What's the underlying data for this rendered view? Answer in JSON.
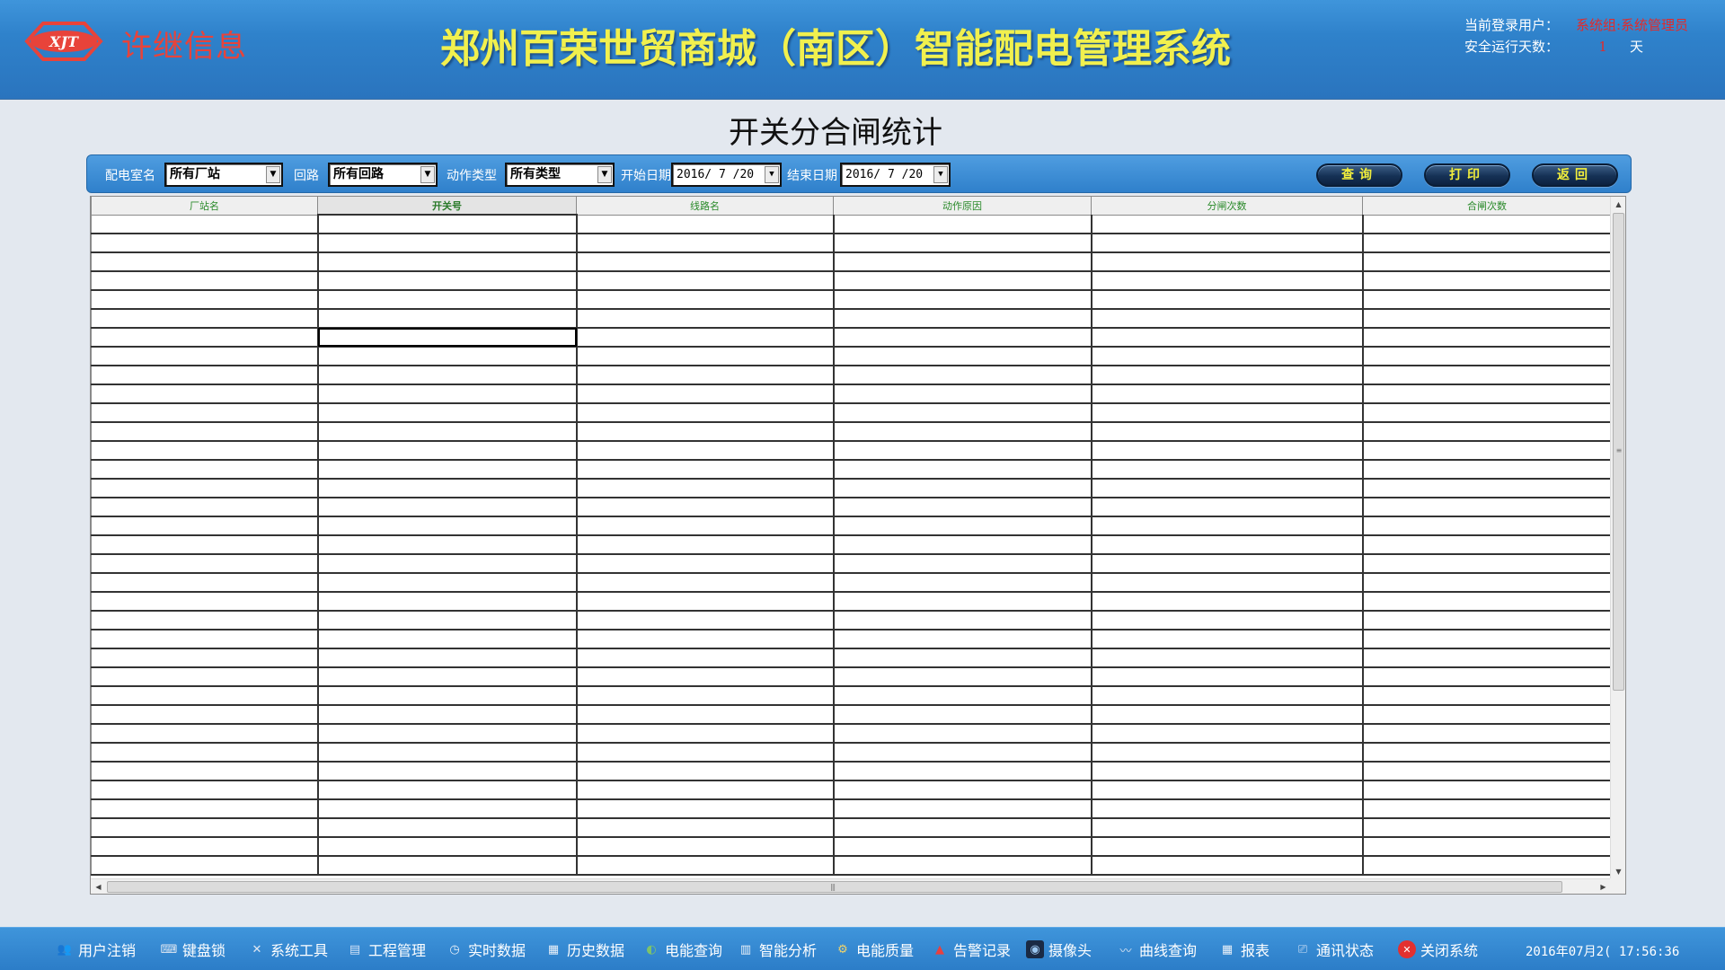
{
  "header": {
    "logo_mark": "XJT",
    "logo_text": "许继信息",
    "system_title": "郑州百荣世贸商城（南区）智能配电管理系统",
    "user_label": "当前登录用户：",
    "user_value": "系统组:系统管理员",
    "days_label": "安全运行天数：",
    "days_value": "1",
    "days_unit": "天"
  },
  "page": {
    "title": "开关分合闸统计"
  },
  "filters": {
    "room_label": "配电室名",
    "room_value": "所有厂站",
    "loop_label": "回路",
    "loop_value": "所有回路",
    "type_label": "动作类型",
    "type_value": "所有类型",
    "start_label": "开始日期",
    "start_value": "2016/ 7 /20",
    "end_label": "结束日期",
    "end_value": "2016/ 7 /20",
    "query_label": "查询",
    "print_label": "打印",
    "back_label": "返回"
  },
  "table": {
    "columns": [
      "厂站名",
      "开关号",
      "线路名",
      "动作原因",
      "分闸次数",
      "合闸次数"
    ],
    "active_column": 1,
    "empty_rows": 35,
    "selected_row": 6,
    "selected_col": 1
  },
  "taskbar": {
    "items": [
      {
        "label": "用户注销",
        "icon": "users-icon"
      },
      {
        "label": "键盘锁",
        "icon": "keyboard-icon"
      },
      {
        "label": "系统工具",
        "icon": "tools-icon"
      },
      {
        "label": "工程管理",
        "icon": "project-icon"
      },
      {
        "label": "实时数据",
        "icon": "realtime-icon"
      },
      {
        "label": "历史数据",
        "icon": "history-icon"
      },
      {
        "label": "电能查询",
        "icon": "energy-icon"
      },
      {
        "label": "智能分析",
        "icon": "analysis-icon"
      },
      {
        "label": "电能质量",
        "icon": "quality-icon"
      },
      {
        "label": "告警记录",
        "icon": "alarm-icon"
      },
      {
        "label": "摄像头",
        "icon": "camera-icon"
      },
      {
        "label": "曲线查询",
        "icon": "curve-icon"
      },
      {
        "label": "报表",
        "icon": "report-icon"
      },
      {
        "label": "通讯状态",
        "icon": "network-icon"
      },
      {
        "label": "关闭系统",
        "icon": "close-icon"
      }
    ],
    "clock": "2016年07月2( 17:56:36"
  },
  "colors": {
    "header_blue": "#2f82cb",
    "title_yellow": "#f1f04e",
    "logo_red": "#e8433a",
    "header_green": "#2a8a2a",
    "button_text": "#f3ef3c"
  }
}
